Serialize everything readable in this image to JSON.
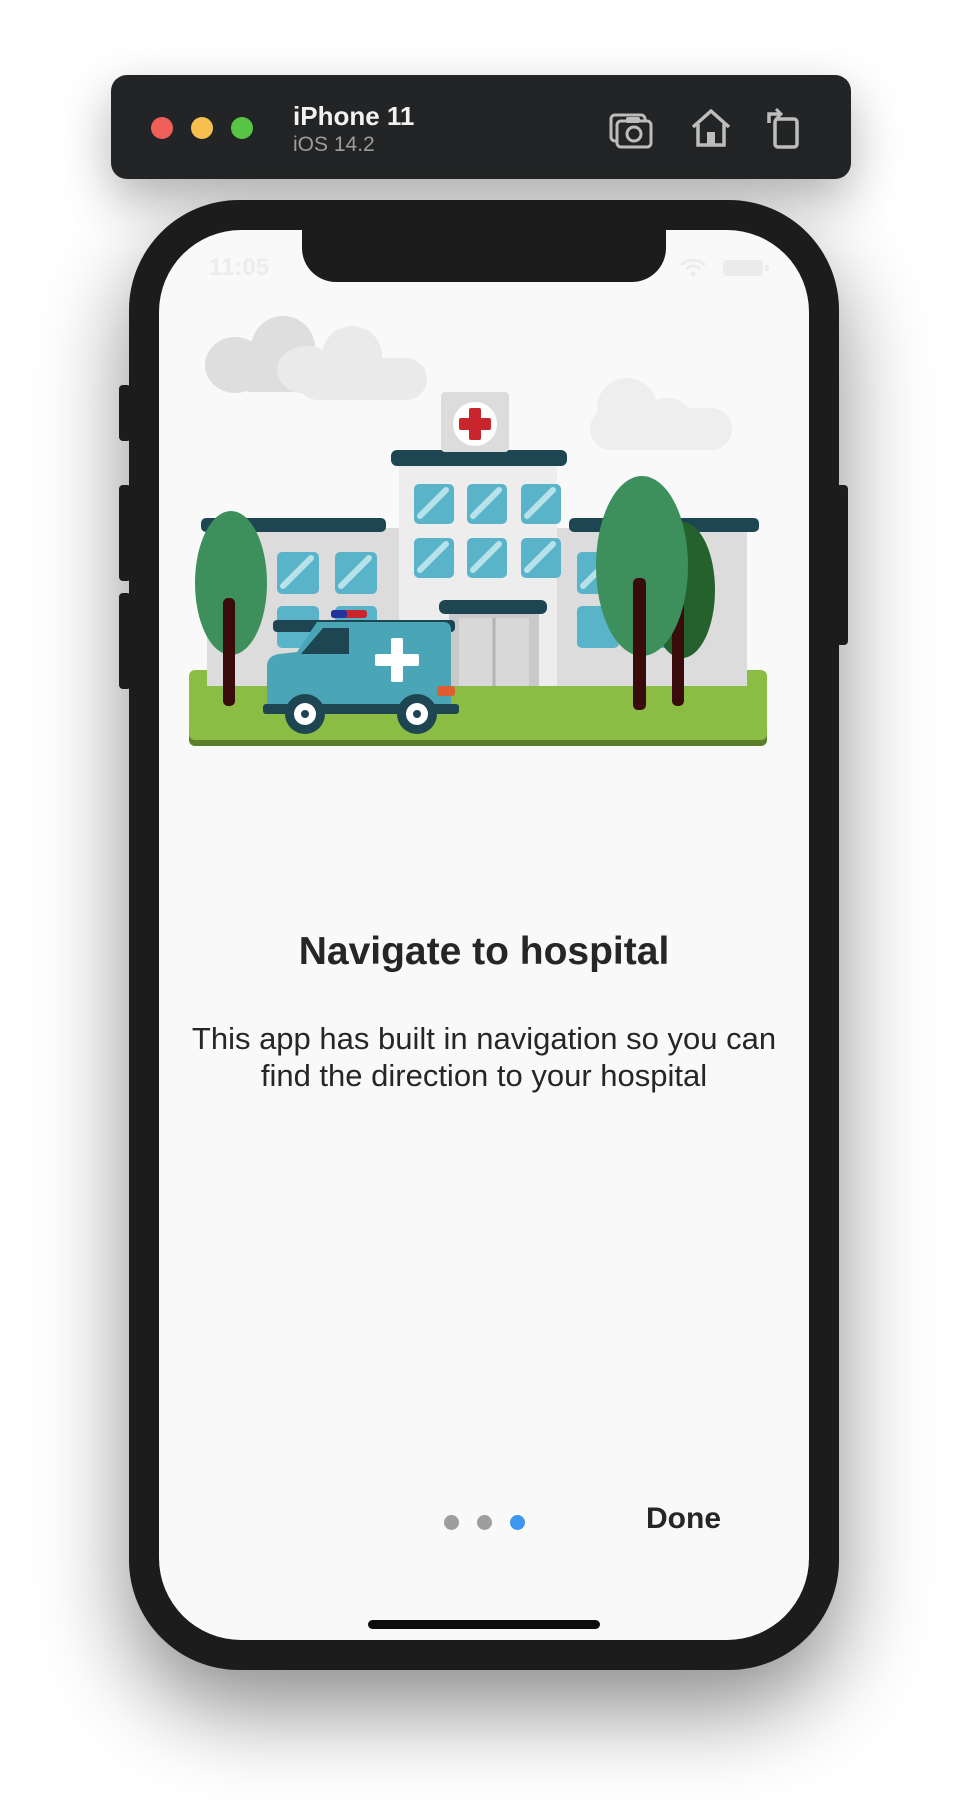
{
  "simulator": {
    "device_name": "iPhone 11",
    "os_version": "iOS 14.2",
    "tools": [
      "screenshot-icon",
      "home-icon",
      "rotate-icon"
    ]
  },
  "status_bar": {
    "time": "11:05"
  },
  "onboarding": {
    "title": "Navigate to hospital",
    "description": "This app has built in navigation so you can find the direction to your hospital",
    "page_dots": 3,
    "active_dot": 3,
    "done_label": "Done",
    "accent_color": "#3d96f0",
    "illustration": "hospital-with-ambulance-illustration"
  }
}
